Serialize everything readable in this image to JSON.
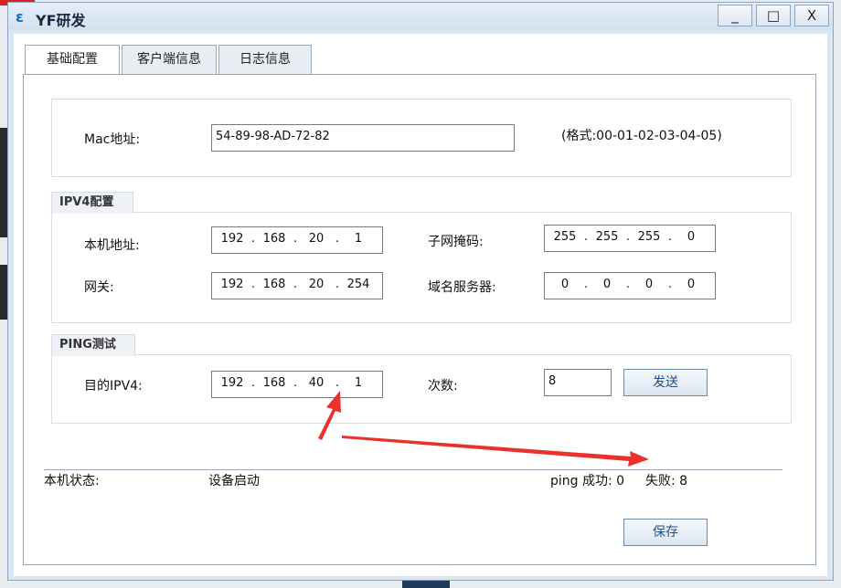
{
  "window": {
    "title": "YF研发",
    "icon": "yf-logo-icon",
    "controls": [
      "_",
      "□",
      "X"
    ]
  },
  "tabs": [
    {
      "label": "基础配置",
      "active": true
    },
    {
      "label": "客户端信息",
      "active": false
    },
    {
      "label": "日志信息",
      "active": false
    }
  ],
  "mac": {
    "label": "Mac地址:",
    "value": "54-89-98-AD-72-82",
    "hint": "(格式:00-01-02-03-04-05)"
  },
  "ipv4": {
    "title": "IPV4配置",
    "local_label": "本机地址:",
    "local": [
      "192",
      "168",
      "20",
      "1"
    ],
    "mask_label": "子网掩码:",
    "mask": [
      "255",
      "255",
      "255",
      "0"
    ],
    "gateway_label": "网关:",
    "gateway": [
      "192",
      "168",
      "20",
      "254"
    ],
    "dns_label": "域名服务器:",
    "dns": [
      "0",
      "0",
      "0",
      "0"
    ]
  },
  "ping": {
    "title": "PING测试",
    "target_label": "目的IPV4:",
    "target": [
      "192",
      "168",
      "40",
      "1"
    ],
    "count_label": "次数:",
    "count": "8",
    "send_label": "发送"
  },
  "status": {
    "label": "本机状态:",
    "value": "设备启动",
    "ping_success": "ping 成功: 0",
    "ping_fail": "失败: 8"
  },
  "save_label": "保存",
  "colors": {
    "annotation_arrow": "#e8322b",
    "title_accent": "#1f6fb8"
  }
}
